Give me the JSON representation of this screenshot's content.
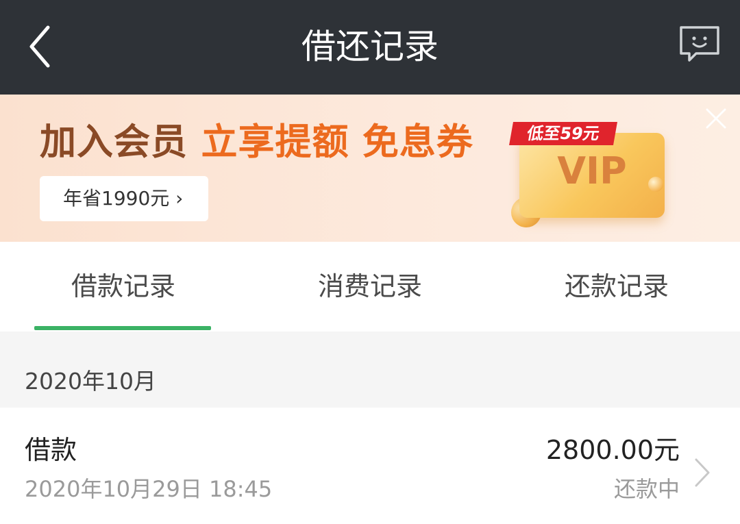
{
  "header": {
    "title": "借还记录",
    "back_icon": "chevron-left-icon",
    "feedback_icon": "chat-smile-icon"
  },
  "banner": {
    "headline_part1": "加入会员 ",
    "headline_part2": "立享提额",
    "headline_part3": " 免息券",
    "savings_label": "年省1990元 ›",
    "vip_tag": "低至59元",
    "vip_text": "VIP",
    "close_icon": "close-icon",
    "colors": {
      "brown": "#8a4a26",
      "orange": "#ec6a1e",
      "tag_red": "#e0242c"
    }
  },
  "tabs": [
    {
      "label": "借款记录",
      "active": true
    },
    {
      "label": "消费记录",
      "active": false
    },
    {
      "label": "还款记录",
      "active": false
    }
  ],
  "active_tab_color": "#3bb265",
  "month_group": {
    "label": "2020年10月",
    "records": [
      {
        "type": "借款",
        "datetime": "2020年10月29日 18:45",
        "amount": "2800.00元",
        "status": "还款中"
      }
    ]
  }
}
